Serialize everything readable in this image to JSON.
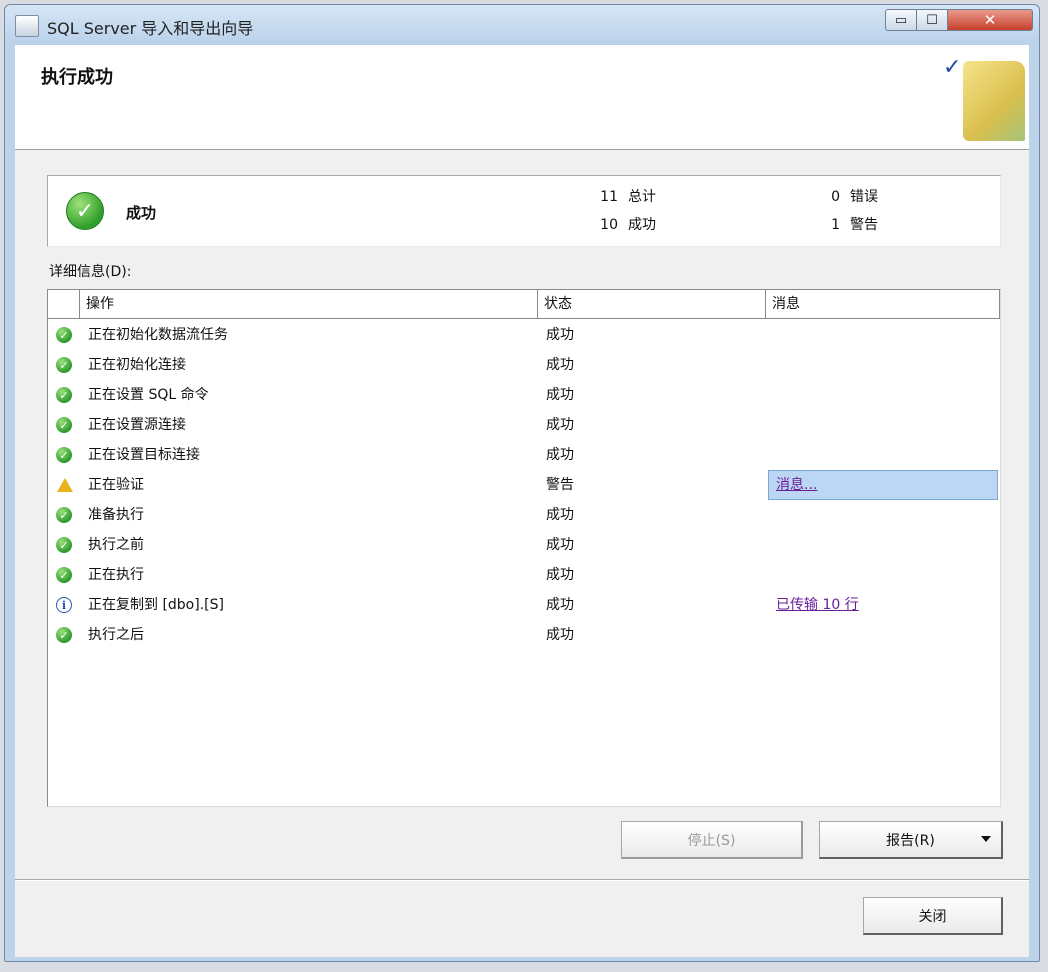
{
  "window": {
    "title": "SQL Server 导入和导出向导",
    "controls": {
      "minimize": "▭",
      "maximize": "☐",
      "close": "✕"
    }
  },
  "header": {
    "title": "执行成功",
    "check": "✓"
  },
  "summary": {
    "status": "成功",
    "stats": [
      {
        "count": "11",
        "label": "总计"
      },
      {
        "count": "10",
        "label": "成功"
      },
      {
        "count": "0",
        "label": "错误"
      },
      {
        "count": "1",
        "label": "警告"
      }
    ]
  },
  "details": {
    "label": "详细信息(D):",
    "columns": [
      "操作",
      "状态",
      "消息"
    ],
    "rows": [
      {
        "icon": "success-icon",
        "action": "正在初始化数据流任务",
        "status": "成功",
        "message": ""
      },
      {
        "icon": "success-icon",
        "action": "正在初始化连接",
        "status": "成功",
        "message": ""
      },
      {
        "icon": "success-icon",
        "action": "正在设置 SQL 命令",
        "status": "成功",
        "message": ""
      },
      {
        "icon": "success-icon",
        "action": "正在设置源连接",
        "status": "成功",
        "message": ""
      },
      {
        "icon": "success-icon",
        "action": "正在设置目标连接",
        "status": "成功",
        "message": ""
      },
      {
        "icon": "warning-icon",
        "action": "正在验证",
        "status": "警告",
        "message": "消息..."
      },
      {
        "icon": "success-icon",
        "action": "准备执行",
        "status": "成功",
        "message": ""
      },
      {
        "icon": "success-icon",
        "action": "执行之前",
        "status": "成功",
        "message": ""
      },
      {
        "icon": "success-icon",
        "action": "正在执行",
        "status": "成功",
        "message": ""
      },
      {
        "icon": "info-icon",
        "action": "正在复制到 [dbo].[S]",
        "status": "成功",
        "message": "已传输 10 行"
      },
      {
        "icon": "success-icon",
        "action": "执行之后",
        "status": "成功",
        "message": ""
      }
    ]
  },
  "buttons": {
    "stop": "停止(S)",
    "report": "报告(R)",
    "close": "关闭"
  }
}
